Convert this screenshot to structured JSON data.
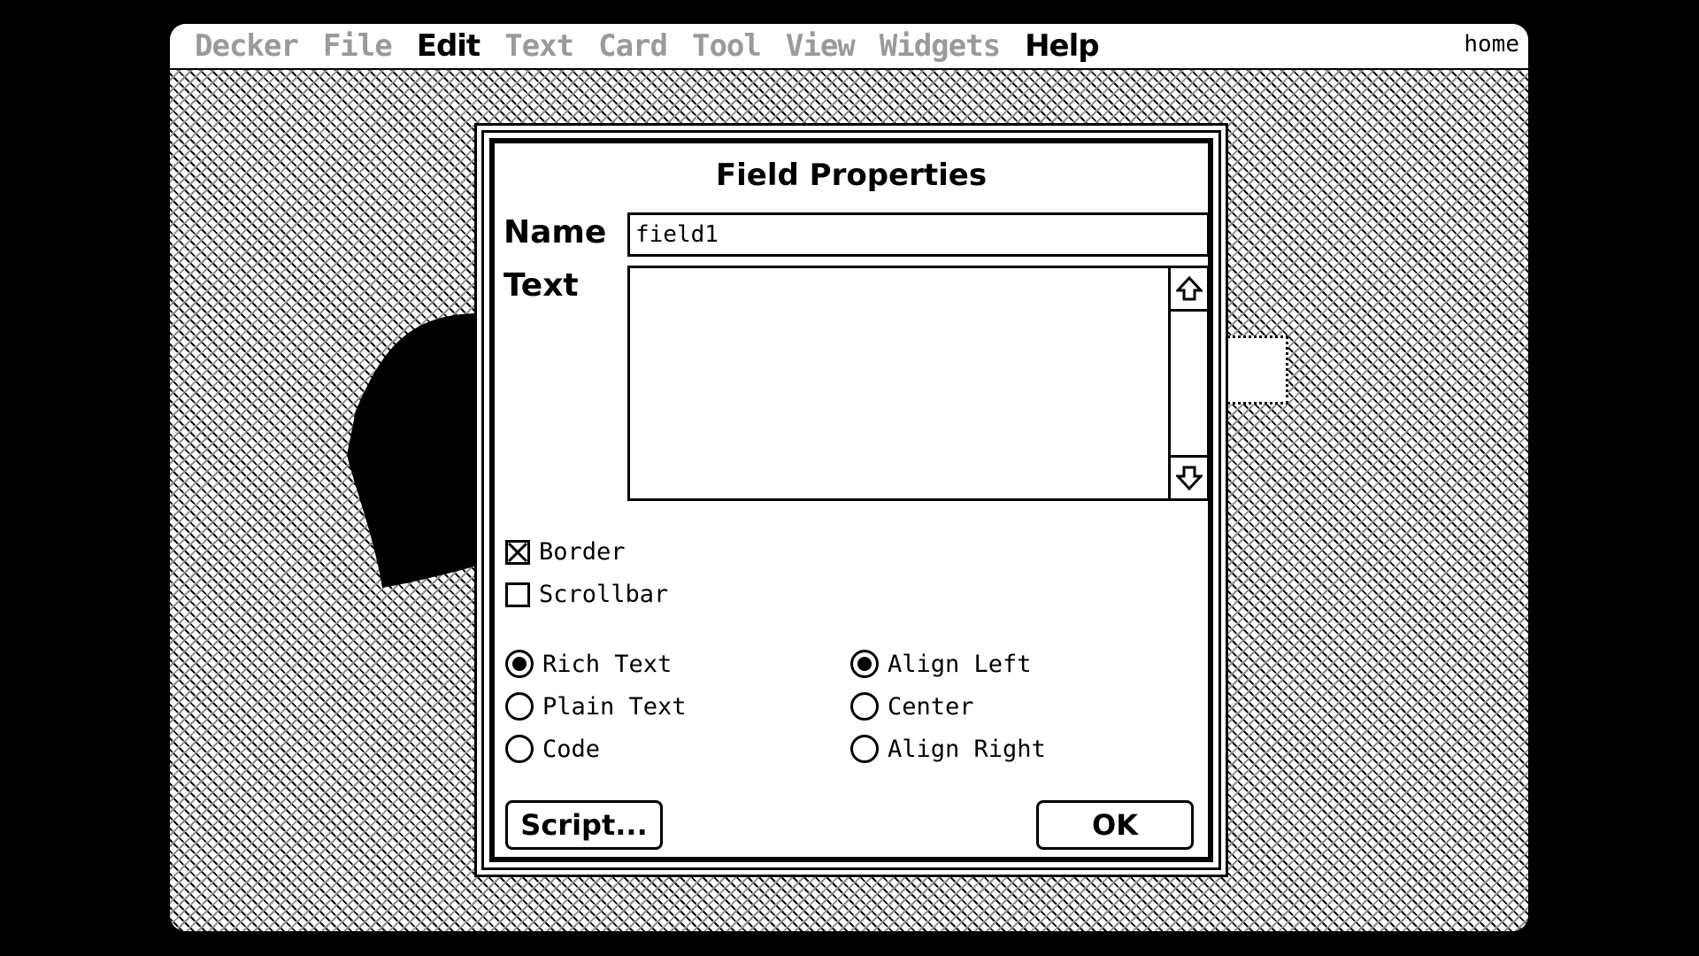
{
  "menubar": {
    "items": [
      {
        "label": "Decker",
        "enabled": false
      },
      {
        "label": "File",
        "enabled": false
      },
      {
        "label": "Edit",
        "enabled": true
      },
      {
        "label": "Text",
        "enabled": false
      },
      {
        "label": "Card",
        "enabled": false
      },
      {
        "label": "Tool",
        "enabled": false
      },
      {
        "label": "View",
        "enabled": false
      },
      {
        "label": "Widgets",
        "enabled": false
      },
      {
        "label": "Help",
        "enabled": true
      }
    ],
    "card_name": "home"
  },
  "dialog": {
    "title": "Field Properties",
    "name_label": "Name",
    "name_value": "field1",
    "text_label": "Text",
    "text_value": "",
    "checkboxes": [
      {
        "label": "Border",
        "checked": true
      },
      {
        "label": "Scrollbar",
        "checked": false
      }
    ],
    "style_radios": [
      {
        "label": "Rich Text",
        "selected": true
      },
      {
        "label": "Plain Text",
        "selected": false
      },
      {
        "label": "Code",
        "selected": false
      }
    ],
    "align_radios": [
      {
        "label": "Align Left",
        "selected": true
      },
      {
        "label": "Center",
        "selected": false
      },
      {
        "label": "Align Right",
        "selected": false
      }
    ],
    "script_button": "Script...",
    "ok_button": "OK"
  },
  "icons": {
    "scroll_up": "arrow-up-icon",
    "scroll_down": "arrow-down-icon",
    "heart": "heart-shape"
  },
  "colors": {
    "foreground": "#000000",
    "background": "#ffffff",
    "frame": "#000000"
  }
}
